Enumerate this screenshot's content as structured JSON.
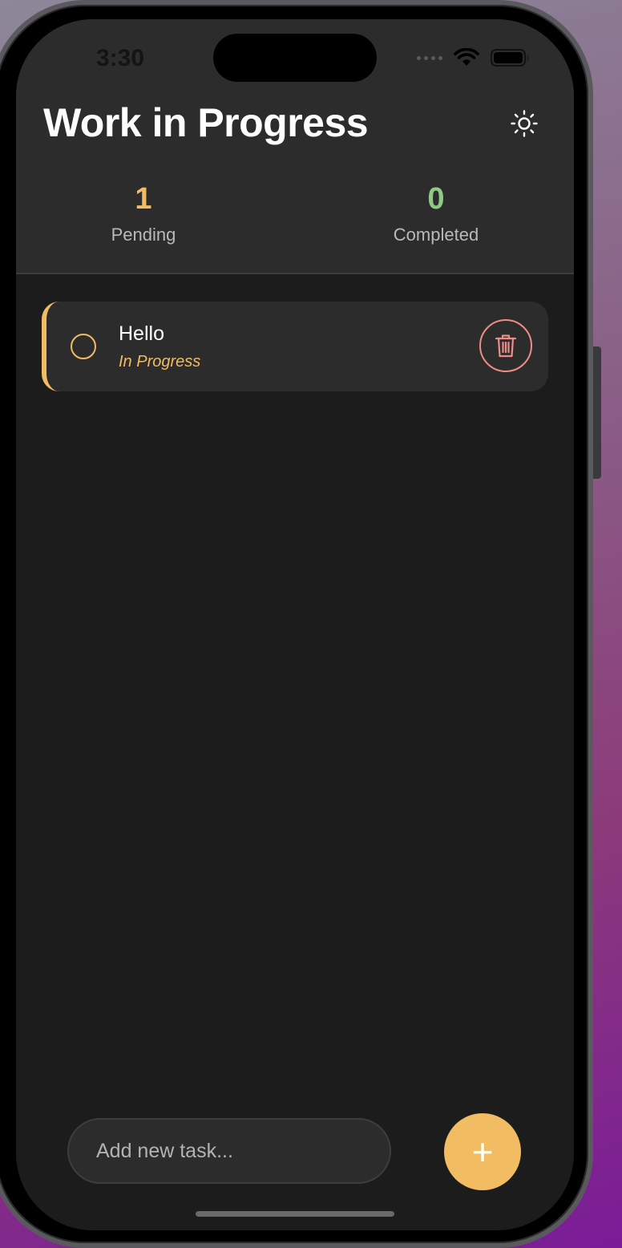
{
  "status_bar": {
    "time": "3:30"
  },
  "header": {
    "title": "Work in Progress",
    "theme_toggle_icon": "sun-icon"
  },
  "stats": {
    "pending": {
      "value": "1",
      "label": "Pending",
      "color": "#f1bc62"
    },
    "completed": {
      "value": "0",
      "label": "Completed",
      "color": "#8fc983"
    }
  },
  "tasks": [
    {
      "name": "Hello",
      "status": "In Progress",
      "accent": "#f1bc62",
      "delete_icon": "trash-icon"
    }
  ],
  "composer": {
    "placeholder": "Add new task...",
    "add_label": "+"
  },
  "colors": {
    "accent": "#f1bc62",
    "delete": "#ec8d86",
    "background": "#1c1c1c",
    "surface": "#2c2c2c"
  }
}
